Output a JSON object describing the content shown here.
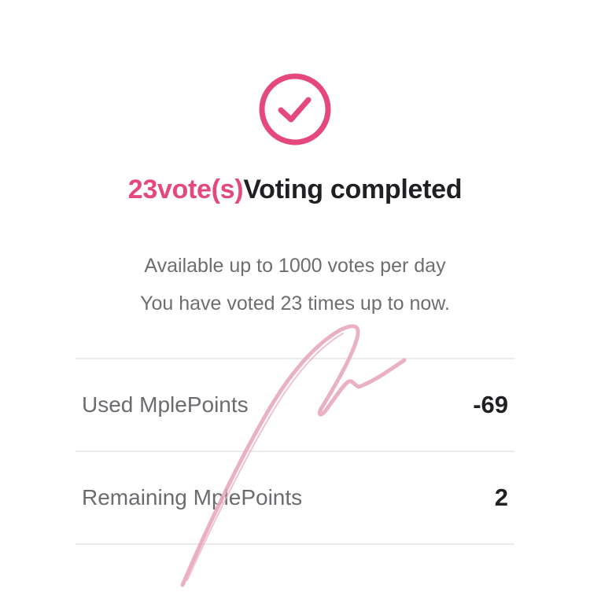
{
  "result": {
    "icon": "check-circle-icon",
    "vote_count": "23vote(s)",
    "status_text": "Voting completed",
    "accent_color": "#e4487d"
  },
  "info": {
    "daily_limit": "Available up to 1000 votes per day",
    "voted_so_far": "You have voted 23 times up to now."
  },
  "points": [
    {
      "label": "Used MplePoints",
      "value": "-69"
    },
    {
      "label": "Remaining MplePoints",
      "value": "2"
    }
  ],
  "overlay": {
    "type": "handwritten-signature",
    "color": "#e8a9bd"
  }
}
